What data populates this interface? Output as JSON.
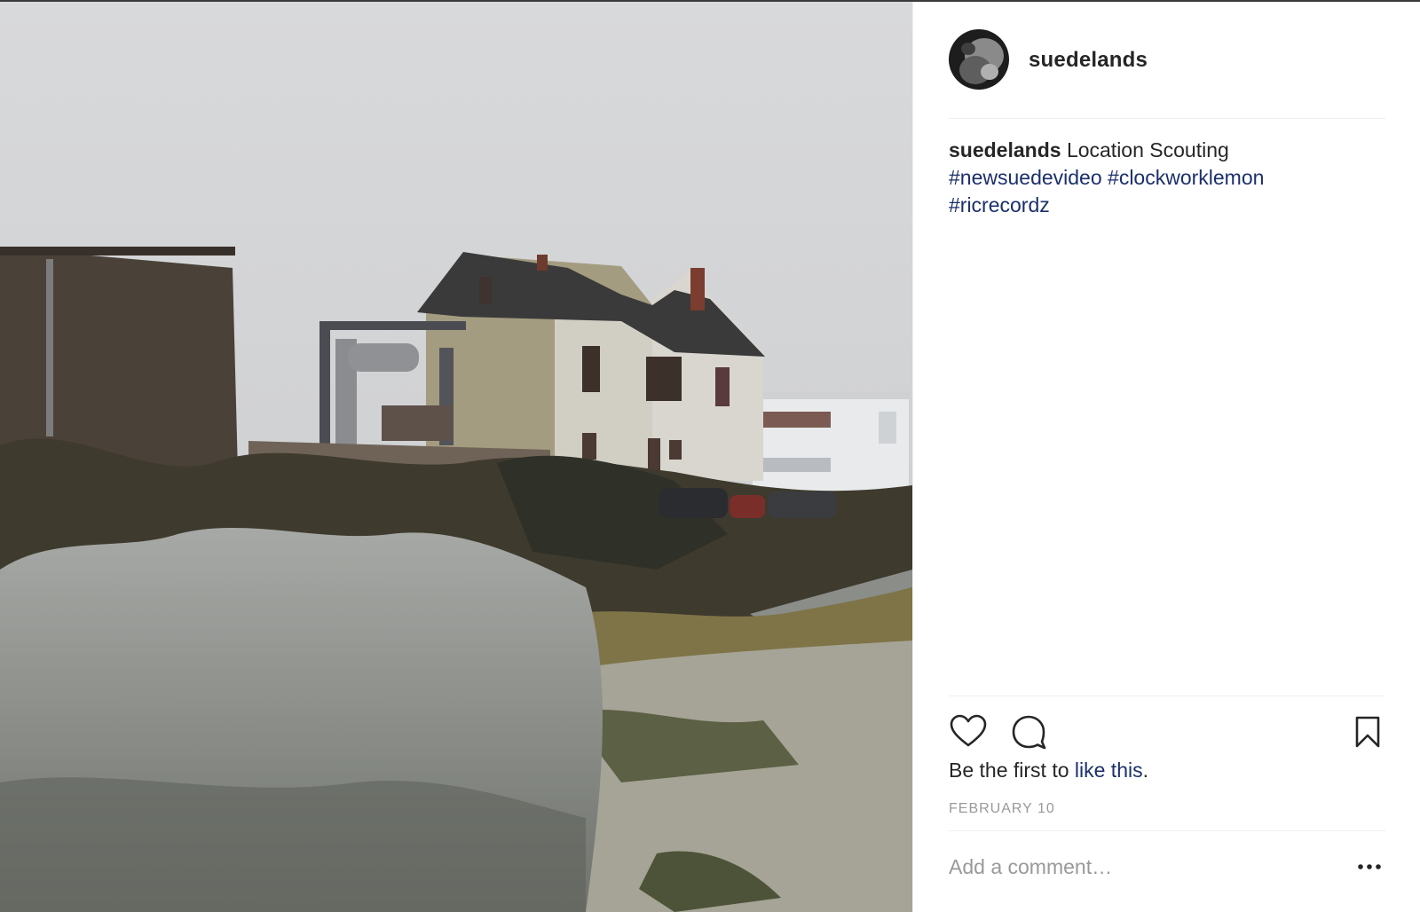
{
  "post": {
    "username": "suedelands",
    "avatar_alt": "suedelands profile picture",
    "photo_alt": "Old house behind overgrown lot"
  },
  "caption": {
    "username": "suedelands",
    "text": "Location Scouting",
    "hashtags": [
      "#newsuedevideo",
      "#clockworklemon",
      "#ricrecordz"
    ]
  },
  "actions": {
    "like_icon": "heart-icon",
    "comment_icon": "comment-icon",
    "save_icon": "bookmark-icon"
  },
  "likes": {
    "prefix": "Be the first to ",
    "link": "like this",
    "suffix": "."
  },
  "date": "FEBRUARY 10",
  "comment": {
    "placeholder": "Add a comment…",
    "more_icon": "more-options-icon"
  },
  "colors": {
    "text": "#262626",
    "link": "#1b2f6b",
    "muted": "#999999",
    "divider": "#efefef"
  }
}
